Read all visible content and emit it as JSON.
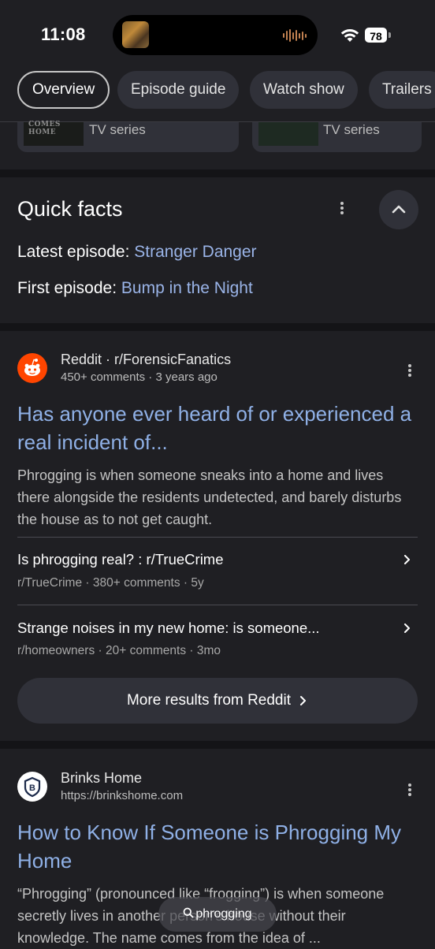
{
  "status_bar": {
    "time": "11:08",
    "battery": "78"
  },
  "tabs": [
    {
      "label": "Overview",
      "active": true
    },
    {
      "label": "Episode guide",
      "active": false
    },
    {
      "label": "Watch show",
      "active": false
    },
    {
      "label": "Trailers",
      "active": false
    }
  ],
  "related_cards": [
    {
      "type": "TV series",
      "thumb_text": "COMES HOME"
    },
    {
      "type": "TV series"
    }
  ],
  "quick_facts": {
    "title": "Quick facts",
    "facts": [
      {
        "label": "Latest episode",
        "value": "Stranger Danger"
      },
      {
        "label": "First episode",
        "value": "Bump in the Night"
      }
    ]
  },
  "results": [
    {
      "source": "Reddit · r/ForensicFanatics",
      "meta": "450+ comments · 3 years ago",
      "title": "Has anyone ever heard of or experienced a real incident of...",
      "snippet": "Phrogging is when someone sneaks into a home and lives there alongside the residents undetected, and barely disturbs the house as to not get caught.",
      "sub_results": [
        {
          "title": "Is phrogging real? : r/TrueCrime",
          "meta": "r/TrueCrime · 380+ comments · 5y"
        },
        {
          "title": "Strange noises in my new home: is someone...",
          "meta": "r/homeowners · 20+ comments · 3mo"
        }
      ],
      "more_label": "More results from Reddit"
    },
    {
      "source": "Brinks Home",
      "meta": "https://brinkshome.com",
      "title": "How to Know If Someone is Phrogging My Home",
      "snippet": "“Phrogging” (pronounced like “frogging”) is when someone secretly lives in another person's house without their knowledge. The name comes from the idea of ..."
    }
  ],
  "search_pill": {
    "query": "phrogging"
  },
  "colors": {
    "background": "#1f1f23",
    "surface": "#303139",
    "link": "#8fb0e6",
    "reddit": "#ff4500"
  }
}
